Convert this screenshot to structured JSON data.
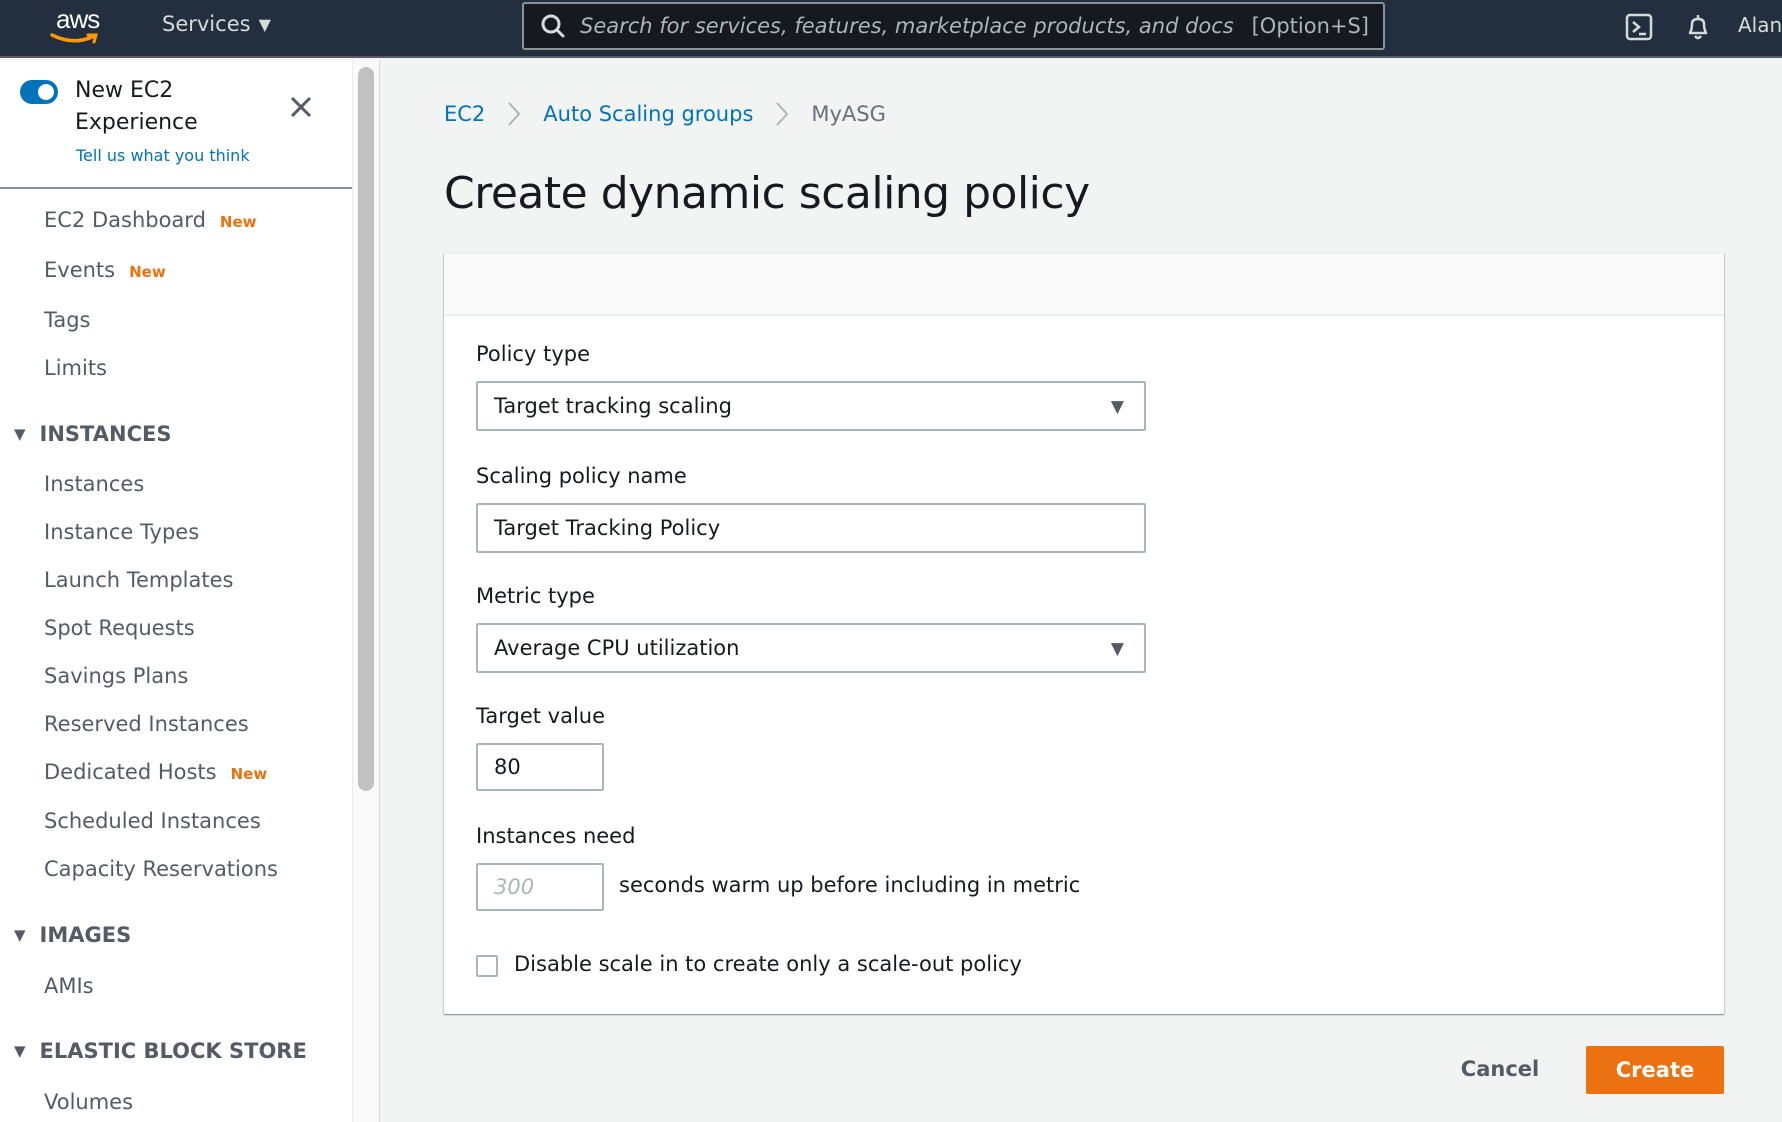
{
  "topnav": {
    "logo_text": "aws",
    "services_label": "Services",
    "search_placeholder": "Search for services, features, marketplace products, and docs",
    "search_shortcut": "[Option+S]",
    "user_name": "Alan",
    "icons": [
      "cloudshell-icon",
      "bell-icon"
    ]
  },
  "sidebar": {
    "new_experience": {
      "title": "New EC2 Experience",
      "enabled": true,
      "feedback_link": "Tell us what you think"
    },
    "top_items": [
      {
        "label": "EC2 Dashboard",
        "badge": "New"
      },
      {
        "label": "Events",
        "badge": "New"
      },
      {
        "label": "Tags",
        "badge": null
      },
      {
        "label": "Limits",
        "badge": null
      }
    ],
    "sections": [
      {
        "title": "INSTANCES",
        "items": [
          {
            "label": "Instances",
            "badge": null
          },
          {
            "label": "Instance Types",
            "badge": null
          },
          {
            "label": "Launch Templates",
            "badge": null
          },
          {
            "label": "Spot Requests",
            "badge": null
          },
          {
            "label": "Savings Plans",
            "badge": null
          },
          {
            "label": "Reserved Instances",
            "badge": null
          },
          {
            "label": "Dedicated Hosts",
            "badge": "New"
          },
          {
            "label": "Scheduled Instances",
            "badge": null
          },
          {
            "label": "Capacity Reservations",
            "badge": null
          }
        ]
      },
      {
        "title": "IMAGES",
        "items": [
          {
            "label": "AMIs",
            "badge": null
          }
        ]
      },
      {
        "title": "ELASTIC BLOCK STORE",
        "items": [
          {
            "label": "Volumes",
            "badge": null
          }
        ]
      }
    ]
  },
  "breadcrumb": [
    {
      "label": "EC2",
      "link": true
    },
    {
      "label": "Auto Scaling groups",
      "link": true
    },
    {
      "label": "MyASG",
      "link": false
    }
  ],
  "page_title": "Create dynamic scaling policy",
  "form": {
    "policy_type": {
      "label": "Policy type",
      "value": "Target tracking scaling"
    },
    "policy_name": {
      "label": "Scaling policy name",
      "value": "Target Tracking Policy"
    },
    "metric_type": {
      "label": "Metric type",
      "value": "Average CPU utilization"
    },
    "target_value": {
      "label": "Target value",
      "value": "80"
    },
    "warmup": {
      "label": "Instances need",
      "placeholder": "300",
      "value": "",
      "suffix": "seconds warm up before including in metric"
    },
    "disable_scale_in": {
      "label": "Disable scale in to create only a scale-out policy",
      "checked": false
    }
  },
  "actions": {
    "cancel": "Cancel",
    "create": "Create"
  },
  "colors": {
    "nav_bg": "#232f3e",
    "link": "#0073bb",
    "primary_button": "#ec7211",
    "badge_new": "#ec7211"
  }
}
